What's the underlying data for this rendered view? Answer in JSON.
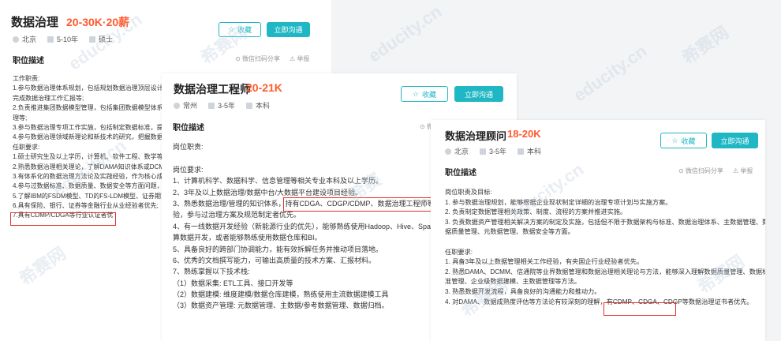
{
  "cards": [
    {
      "title": "数据治理",
      "salary": "20-30K·20薪",
      "meta": [
        "北京",
        "5-10年",
        "硕士"
      ],
      "fav": "收藏",
      "chat": "立即沟通",
      "section": "职位描述",
      "share": "微信扫码分享",
      "report": "举报",
      "lines": [
        "工作职责:",
        "1.参与数据治理体系规划，包括规划数据治理顶层设计、起",
        "完成数据治理工作汇报等;",
        "2.负责推进集团数据模型管理，包括集团数据模型体系建设",
        "理等;",
        "3.参与数据治理专项工作实施，包括制定数据标准，提升重",
        "4.参与数据治理领域新理论和新技术的研究，把握数据治理",
        "任职要求:",
        "1.硕士研究生及以上学历，计算机、软件工程、数学等相关",
        "2.熟悉数据治理相关理论，了解DAMA知识体系或DCMM框",
        "3.有体系化的数据治理方法论及实践经验，作为核心成员参",
        "4.参与过数据标准、数据质量、数据安全等方面问题，主导",
        "5.了解IBM的FSDM模型、TD的FS-LDM模型、证券期货业",
        "6.具有保险、银行、证券等金融行业从业经验者优先;",
        "7.具有CDMP/CDGA等行业认证者优"
      ]
    },
    {
      "title": "数据治理工程师",
      "salary": "20-21K",
      "meta": [
        "常州",
        "3-5年",
        "本科"
      ],
      "fav": "收藏",
      "chat": "立即沟通",
      "section": "职位描述",
      "share": "微信",
      "lines": [
        "岗位职责:",
        "",
        "岗位要求:",
        "1、计算机科学、数据科学、信息管理等相关专业本科及以上学历。",
        "2、3年及以上数据治理/数据中台/大数据平台建设项目经验。",
        "3、熟悉数据治理/管理的知识体系，持有CDGA、CDGP/CDMP、数据治理工程师等认证，有",
        "验，参与过治理方案及规范制定者优先。",
        "4、有一线数据开发经验（新能源行业的优先），能够熟练使用Hadoop、Hive、Spark、Flink",
        "算数据开发，或者能够熟练使用数据仓库和BI。",
        "5、具备良好的跨部门协调能力，能有效拆解任务并推动项目落地。",
        "6、优秀的文档撰写能力，可输出高质量的技术方案、汇报材料。",
        "7、熟练掌握以下技术栈:",
        "（1）数据采集: ETL工具、接口开发等",
        "（2）数据建模: 维度建模/数据仓库建模，熟练使用主流数据建模工具",
        "（3）数据资产管理: 元数据管理、主数据/参考数据管理、数据归档。"
      ]
    },
    {
      "title": "数据治理顾问",
      "salary": "18-20K",
      "meta": [
        "北京",
        "3-5年",
        "本科"
      ],
      "fav": "收藏",
      "chat": "立即沟通",
      "section": "职位描述",
      "share": "微信扫码分享",
      "report": "举报",
      "lines": [
        "岗位职责及目标:",
        "1. 参与数据治理规划，能够根据企业现状制定详细的治理专项计划与实施方案。",
        "2. 负责制定数据管理相关政策、制度、流程的方案并推进实施。",
        "3. 负责数据资产管理相关解决方案的制定及实施，包括但不限于数据架构与标准、数据治理体系、主数据管理、数",
        "据质量管理、元数据管理、数据安全等方面。",
        "",
        "任职要求:",
        "1. 具备3年及以上数据管理相关工作经验，有央国企行业经验者优先。",
        "2. 熟悉DAMA、DCMM、信通院等业界数据管理和数据治理相关理论与方法，能够深入理解数据质量管理、数据标",
        "准管理、企业级数据建模、主数据管理等方法。",
        "3. 熟悉数据开发流程，具备良好的沟通能力和推动力。",
        "4. 对DAMA、数据成熟度评估等方法论有较深刻的理解，有CDMP、CDGA、CDGP等数据治理证书者优先。"
      ]
    }
  ],
  "watermarks": [
    "educity.cn",
    "希赛网",
    "educity.cn",
    "希赛",
    "educity.cn",
    "希赛网",
    "希赛网",
    "educity.cn",
    "希赛网",
    "educity.cn",
    "希赛网"
  ],
  "colors": {
    "accent": "#1fb7c4",
    "salary": "#ff5a2c",
    "highlight": "#e0302a"
  }
}
